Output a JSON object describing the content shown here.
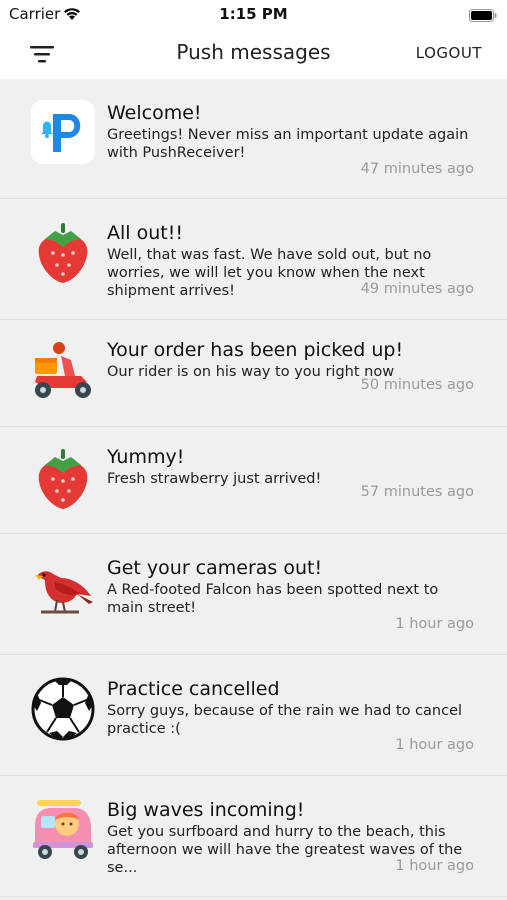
{
  "status_bar": {
    "carrier": "Carrier",
    "time": "1:15 PM"
  },
  "nav": {
    "title": "Push messages",
    "logout_label": "LOGOUT"
  },
  "messages": [
    {
      "icon": "pushreceiver-logo-icon",
      "title": "Welcome!",
      "body": "Greetings! Never miss an important update again with PushReceiver!",
      "time": "47 minutes ago"
    },
    {
      "icon": "strawberry-icon",
      "title": "All out!!",
      "body": "Well, that was fast. We have sold out, but no worries, we will let you know when the next shipment arrives!",
      "time": "49 minutes ago"
    },
    {
      "icon": "scooter-delivery-icon",
      "title": "Your order has been picked up!",
      "body": "Our rider is on his way to you right now",
      "time": "50 minutes ago"
    },
    {
      "icon": "strawberry-icon",
      "title": "Yummy!",
      "body": "Fresh strawberry just arrived!",
      "time": "57 minutes ago"
    },
    {
      "icon": "bird-icon",
      "title": "Get your cameras out!",
      "body": "A Red-footed Falcon has been spotted next to main street!",
      "time": "1 hour ago"
    },
    {
      "icon": "soccer-ball-icon",
      "title": "Practice cancelled",
      "body": "Sorry guys, because of the rain we had to cancel practice :(",
      "time": "1 hour ago"
    },
    {
      "icon": "surfer-van-icon",
      "title": "Big waves incoming!",
      "body": "Get you surfboard and hurry to the beach, this afternoon we will have the greatest waves of the se...",
      "time": "1 hour ago"
    }
  ]
}
